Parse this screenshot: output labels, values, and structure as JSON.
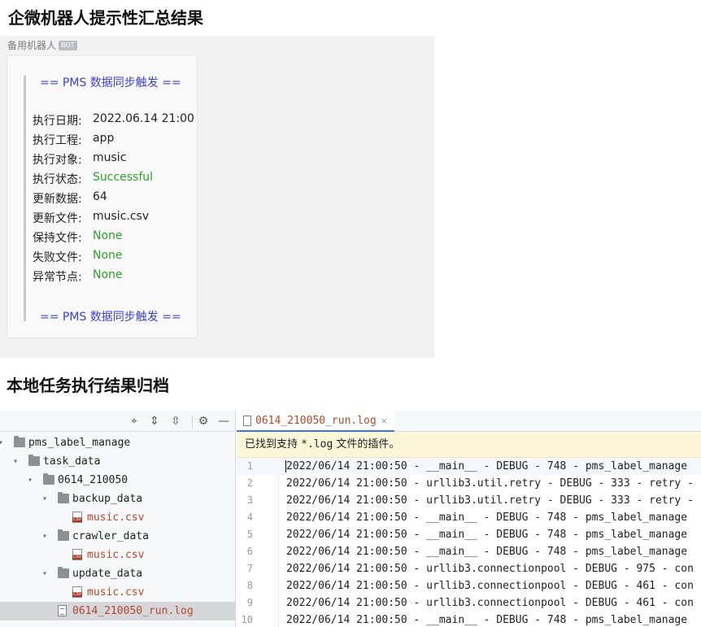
{
  "titles": {
    "summary": "企微机器人提示性汇总结果",
    "archive": "本地任务执行结果归档"
  },
  "wecom": {
    "sender": "备用机器人",
    "badge": "BOT",
    "banner_top": "== PMS 数据同步触发 ==",
    "banner_bottom": "== PMS 数据同步触发 ==",
    "fields": [
      {
        "key": "执行日期:",
        "value": "2022.06.14 21:00",
        "color": "#222222"
      },
      {
        "key": "执行工程:",
        "value": "app",
        "color": "#222222"
      },
      {
        "key": "执行对象:",
        "value": "music",
        "color": "#222222"
      },
      {
        "key": "执行状态:",
        "value": "Successful",
        "color": "#2ca02c"
      },
      {
        "key": "更新数据:",
        "value": "64",
        "color": "#222222"
      },
      {
        "key": "更新文件:",
        "value": "music.csv",
        "color": "#222222"
      },
      {
        "key": "保持文件:",
        "value": "None",
        "color": "#2ca02c"
      },
      {
        "key": "失败文件:",
        "value": "None",
        "color": "#2ca02c"
      },
      {
        "key": "异常节点:",
        "value": "None",
        "color": "#2ca02c"
      }
    ]
  },
  "ide": {
    "toolbar_icons": [
      "crosshair-icon",
      "expand-all-icon",
      "collapse-all-icon",
      "gear-icon",
      "minimize-icon"
    ],
    "tree": [
      {
        "label": "pms_label_manage",
        "type": "folder",
        "expanded": true
      },
      {
        "label": "task_data",
        "type": "folder",
        "expanded": true
      },
      {
        "label": "0614_210050",
        "type": "folder",
        "expanded": true
      },
      {
        "label": "backup_data",
        "type": "folder",
        "expanded": true
      },
      {
        "label": "music.csv",
        "type": "csv"
      },
      {
        "label": "crawler_data",
        "type": "folder",
        "expanded": true
      },
      {
        "label": "music.csv",
        "type": "csv"
      },
      {
        "label": "update_data",
        "type": "folder",
        "expanded": true
      },
      {
        "label": "music.csv",
        "type": "csv"
      },
      {
        "label": "0614_210050_run.log",
        "type": "log",
        "selected": true
      }
    ],
    "tab": {
      "label": "0614_210050_run.log",
      "close": "×"
    },
    "notice": {
      "prefix": "已找到支持 ",
      "ext": "*.log",
      "suffix": " 文件的插件。"
    },
    "lines": [
      {
        "num": "1",
        "text": "2022/06/14 21:00:50 - __main__ - DEBUG - 748 - pms_label_manage"
      },
      {
        "num": "2",
        "text": "2022/06/14 21:00:50 - urllib3.util.retry - DEBUG - 333 - retry -"
      },
      {
        "num": "3",
        "text": "2022/06/14 21:00:50 - urllib3.util.retry - DEBUG - 333 - retry -"
      },
      {
        "num": "4",
        "text": "2022/06/14 21:00:50 - __main__ - DEBUG - 748 - pms_label_manage"
      },
      {
        "num": "5",
        "text": "2022/06/14 21:00:50 - __main__ - DEBUG - 748 - pms_label_manage"
      },
      {
        "num": "6",
        "text": "2022/06/14 21:00:50 - __main__ - DEBUG - 748 - pms_label_manage"
      },
      {
        "num": "7",
        "text": "2022/06/14 21:00:50 - urllib3.connectionpool - DEBUG - 975 - con"
      },
      {
        "num": "8",
        "text": "2022/06/14 21:00:50 - urllib3.connectionpool - DEBUG - 461 - con"
      },
      {
        "num": "9",
        "text": "2022/06/14 21:00:50 - urllib3.connectionpool - DEBUG - 461 - con"
      },
      {
        "num": "10",
        "text": "2022/06/14 21:00:50 - __main__ - DEBUG - 748 - pms_label_manage"
      }
    ]
  }
}
